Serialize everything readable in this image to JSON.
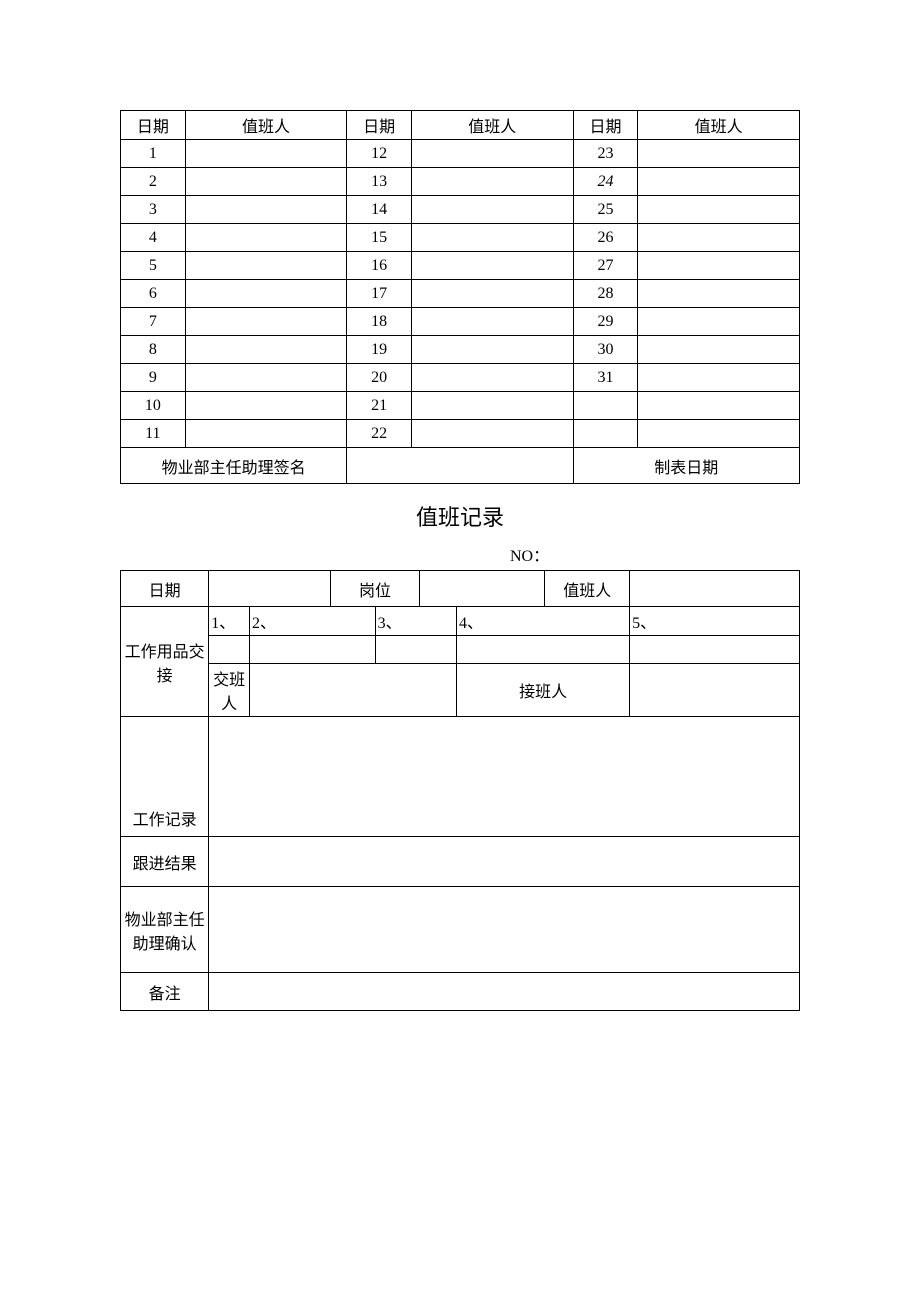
{
  "schedule": {
    "headers": {
      "date": "日期",
      "person": "值班人"
    },
    "col1_dates": [
      "1",
      "2",
      "3",
      "4",
      "5",
      "6",
      "7",
      "8",
      "9",
      "10",
      "11"
    ],
    "col2_dates": [
      "12",
      "13",
      "14",
      "15",
      "16",
      "17",
      "18",
      "19",
      "20",
      "21",
      "22"
    ],
    "col3_dates": [
      "23",
      "24",
      "25",
      "26",
      "27",
      "28",
      "29",
      "30",
      "31",
      "",
      ""
    ],
    "signature_label": "物业部主任助理签名",
    "form_date_label": "制表日期"
  },
  "record": {
    "title": "值班记录",
    "no_label": "NO：",
    "labels": {
      "date": "日期",
      "post": "岗位",
      "person": "值班人",
      "supplies": "工作用品交接",
      "handover": "交班人",
      "receiver": "接班人",
      "log": "工作记录",
      "follow": "跟进结果",
      "confirm": "物业部主任助理确认",
      "remark": "备注"
    },
    "items": [
      "1、",
      "2、",
      "3、",
      "4、",
      "5、"
    ]
  }
}
